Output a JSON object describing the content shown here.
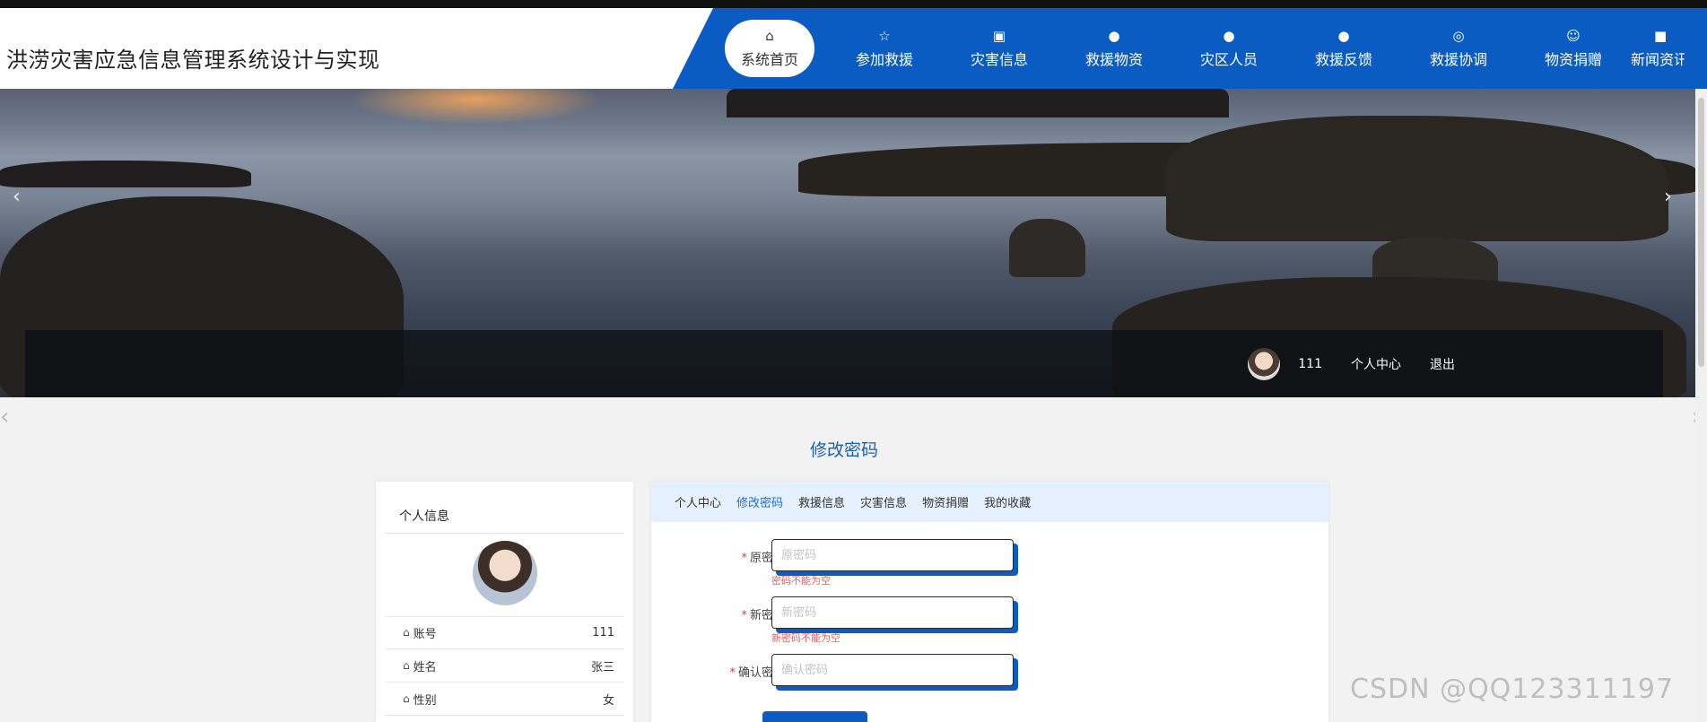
{
  "header": {
    "title": "洪涝灾害应急信息管理系统设计与实现"
  },
  "nav": [
    {
      "label": "系统首页",
      "icon": "home-icon",
      "glyph": "⌂"
    },
    {
      "label": "参加救援",
      "icon": "star-icon",
      "glyph": "☆"
    },
    {
      "label": "灾害信息",
      "icon": "bag-icon",
      "glyph": "▣"
    },
    {
      "label": "救援物资",
      "icon": "alert-icon",
      "glyph": "●"
    },
    {
      "label": "灾区人员",
      "icon": "question-icon",
      "glyph": "●"
    },
    {
      "label": "救援反馈",
      "icon": "info-icon",
      "glyph": "●"
    },
    {
      "label": "救援协调",
      "icon": "lifebuoy-icon",
      "glyph": "◎"
    },
    {
      "label": "物资捐赠",
      "icon": "smile-icon",
      "glyph": "☺"
    },
    {
      "label": "新闻资讯",
      "icon": "camera-icon",
      "glyph": "■"
    }
  ],
  "banner": {
    "prev": "‹",
    "next": "›"
  },
  "user": {
    "name": "111",
    "center": "个人中心",
    "logout": "退出"
  },
  "page": {
    "heading": "修改密码"
  },
  "profile": {
    "title": "个人信息",
    "rows": [
      {
        "label": "账号",
        "value": "111"
      },
      {
        "label": "姓名",
        "value": "张三"
      },
      {
        "label": "性别",
        "value": "女"
      }
    ]
  },
  "tabs": [
    "个人中心",
    "修改密码",
    "救援信息",
    "灾害信息",
    "物资捐赠",
    "我的收藏"
  ],
  "form": {
    "old": {
      "label": "原密码",
      "placeholder": "原密码",
      "error": "密码不能为空"
    },
    "new": {
      "label": "新密码",
      "placeholder": "新密码",
      "error": "新密码不能为空"
    },
    "confirm": {
      "label": "确认密码",
      "placeholder": "确认密码"
    }
  },
  "watermark": "CSDN @QQ123311197",
  "colors": {
    "nav": "#0a5cc2",
    "accent": "#1a6ed8",
    "error": "#f05a5a"
  }
}
